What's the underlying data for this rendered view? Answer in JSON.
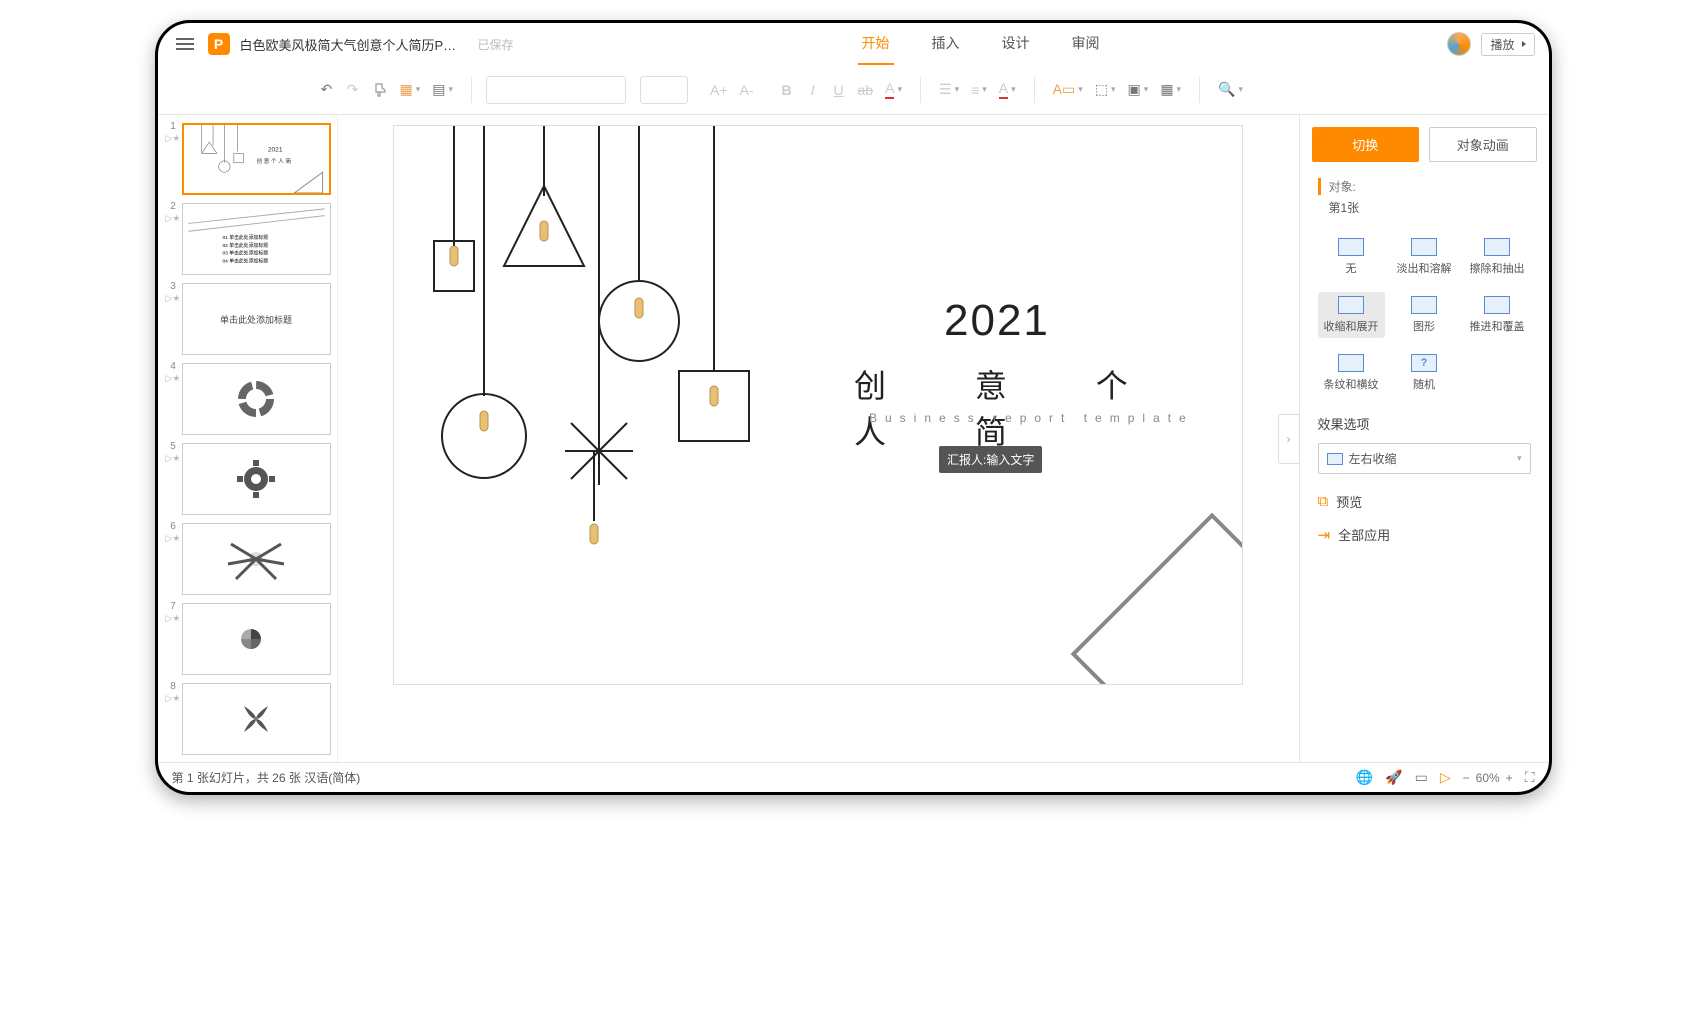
{
  "header": {
    "file_title": "白色欧美风极简大气创意个人简历PPT...",
    "saved_label": "已保存",
    "tabs": [
      "开始",
      "插入",
      "设计",
      "审阅"
    ],
    "active_tab": 0,
    "play_label": "播放"
  },
  "toolbar": {
    "font_increase": "A+",
    "font_decrease": "A-",
    "bold": "B",
    "italic": "I",
    "underline": "U",
    "strike": "ab",
    "fontcolor": "A"
  },
  "slide": {
    "year": "2021",
    "title": "创 意 个 人 简",
    "subtitle": "Business report template",
    "reporter": "汇报人:输入文字"
  },
  "thumbs": {
    "count": 8,
    "slide3_text": "单击此处添加标题"
  },
  "panel": {
    "tab_switch": "切换",
    "tab_animation": "对象动画",
    "object_label": "对象:",
    "object_value": "第1张",
    "transitions": [
      "无",
      "淡出和溶解",
      "擦除和抽出",
      "收缩和展开",
      "图形",
      "推进和覆盖",
      "条纹和横纹",
      "随机"
    ],
    "selected_transition": 3,
    "effect_title": "效果选项",
    "effect_value": "左右收缩",
    "preview": "预览",
    "apply_all": "全部应用"
  },
  "status": {
    "text": "第 1 张幻灯片，共 26 张  汉语(简体)",
    "zoom": "60%"
  }
}
